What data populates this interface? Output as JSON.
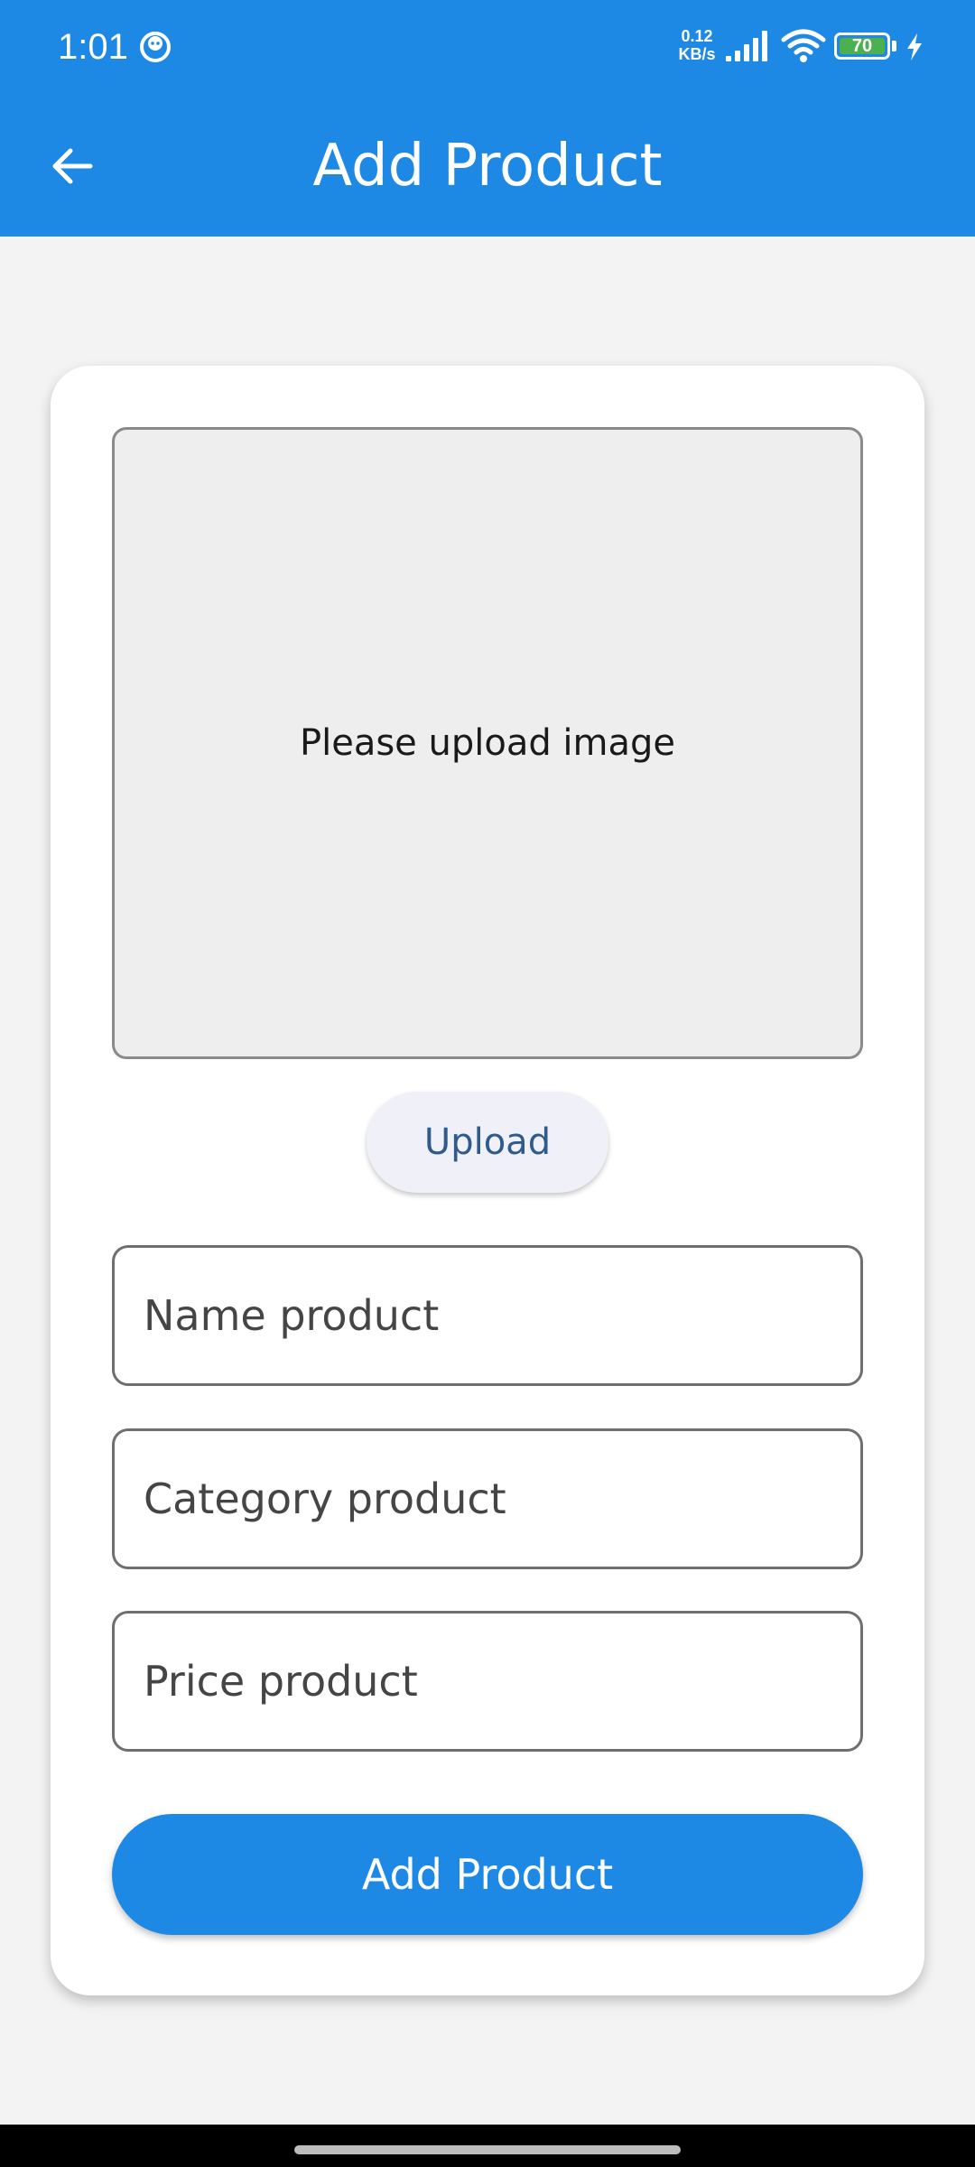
{
  "status_bar": {
    "time": "1:01",
    "network_speed": "0.12 KB/s",
    "battery_level": "70",
    "icons": [
      "face-icon",
      "signal-icon",
      "wifi-icon",
      "battery-icon",
      "charging-bolt-icon"
    ]
  },
  "app_bar": {
    "title": "Add Product",
    "back_icon": "arrow-back-icon"
  },
  "form": {
    "image_placeholder": "Please upload image",
    "upload_label": "Upload",
    "name_placeholder": "Name product",
    "category_placeholder": "Category product",
    "price_placeholder": "Price product",
    "name_value": "",
    "category_value": "",
    "price_value": "",
    "submit_label": "Add Product"
  },
  "colors": {
    "primary": "#1e88e5",
    "background": "#f3f3f3",
    "card": "#ffffff",
    "upload_button_text": "#2f5a8c"
  }
}
